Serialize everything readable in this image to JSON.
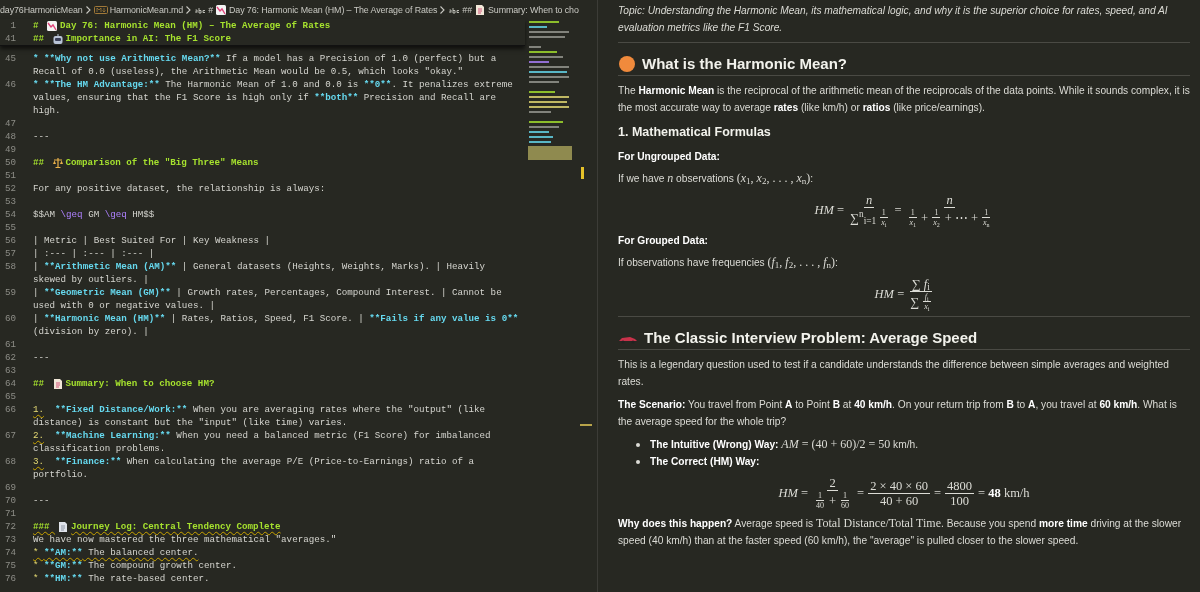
{
  "breadcrumbs": [
    {
      "kind": "folder",
      "text": "day76HarmonicMean"
    },
    {
      "kind": "file",
      "text": "HarmonicMean.md"
    },
    {
      "kind": "heading",
      "marker": "#",
      "emoji": true,
      "text": "Day 76: Harmonic Mean (HM) – The Average of Rates"
    },
    {
      "kind": "heading",
      "marker": "##",
      "emoji": true,
      "text": "Summary: When to cho"
    }
  ],
  "editor": {
    "sticky": [
      {
        "number": "1",
        "rows": [
          [
            {
              "kind": "heading",
              "text": "# "
            },
            {
              "kind": "emoji"
            },
            {
              "kind": "heading",
              "text": "Day 76: Harmonic Mean (HM) – The Average of Rates"
            }
          ]
        ]
      },
      {
        "number": "41",
        "rows": [
          [
            {
              "kind": "heading",
              "text": "## "
            },
            {
              "kind": "emoji"
            },
            {
              "kind": "heading",
              "text": "Importance in AI: The F1 Score"
            }
          ]
        ]
      }
    ],
    "lines": [
      {
        "number": "45",
        "rows": [
          [
            {
              "kind": "bold",
              "text": "* **Why not use Arithmetic Mean?**"
            },
            {
              "kind": "text",
              "text": " If a model has a Precision of 1.0 (perfect) but a"
            }
          ],
          [
            {
              "kind": "text",
              "text": "Recall of 0.0 (useless), the Arithmetic Mean would be 0.5, which looks \"okay.\""
            }
          ]
        ]
      },
      {
        "number": "46",
        "rows": [
          [
            {
              "kind": "bold",
              "text": "* **The HM Advantage:**"
            },
            {
              "kind": "text",
              "text": " The Harmonic Mean of 1.0 and 0.0 is "
            },
            {
              "kind": "bold",
              "text": "**0**"
            },
            {
              "kind": "text",
              "text": ". It penalizes extreme"
            }
          ],
          [
            {
              "kind": "text",
              "text": "values, ensuring that the F1 Score is high only if "
            },
            {
              "kind": "bold",
              "text": "**both**"
            },
            {
              "kind": "text",
              "text": " Precision and Recall are"
            }
          ],
          [
            {
              "kind": "text",
              "text": "high."
            }
          ]
        ]
      },
      {
        "number": "47"
      },
      {
        "number": "48",
        "rows": [
          [
            {
              "kind": "text",
              "text": "---"
            }
          ]
        ]
      },
      {
        "number": "49"
      },
      {
        "number": "50",
        "rows": [
          [
            {
              "kind": "heading",
              "text": "## "
            },
            {
              "kind": "emoji"
            },
            {
              "kind": "heading",
              "text": "Comparison of the \"Big Three\" Means"
            }
          ]
        ]
      },
      {
        "number": "51"
      },
      {
        "number": "52",
        "rows": [
          [
            {
              "kind": "text",
              "text": "For any positive dataset, the relationship is always:"
            }
          ]
        ]
      },
      {
        "number": "53"
      },
      {
        "number": "54",
        "rows": [
          [
            {
              "kind": "text",
              "text": "$$AM "
            },
            {
              "kind": "command",
              "text": "\\geq"
            },
            {
              "kind": "text",
              "text": " GM "
            },
            {
              "kind": "command",
              "text": "\\geq"
            },
            {
              "kind": "text",
              "text": " HM$$"
            }
          ]
        ]
      },
      {
        "number": "55"
      },
      {
        "number": "56",
        "rows": [
          [
            {
              "kind": "text",
              "text": "| Metric | Best Suited For | Key Weakness |"
            }
          ]
        ]
      },
      {
        "number": "57",
        "rows": [
          [
            {
              "kind": "text",
              "text": "| :--- | :--- | :--- |"
            }
          ]
        ]
      },
      {
        "number": "58",
        "rows": [
          [
            {
              "kind": "text",
              "text": "| "
            },
            {
              "kind": "bold",
              "text": "**Arithmetic Mean (AM)**"
            },
            {
              "kind": "text",
              "text": " | General datasets (Heights, Weights, Marks). | Heavily"
            }
          ],
          [
            {
              "kind": "text",
              "text": "skewed by outliers. |"
            }
          ]
        ]
      },
      {
        "number": "59",
        "rows": [
          [
            {
              "kind": "text",
              "text": "| "
            },
            {
              "kind": "bold",
              "text": "**Geometric Mean (GM)**"
            },
            {
              "kind": "text",
              "text": " | Growth rates, Percentages, Compound Interest. | Cannot be"
            }
          ],
          [
            {
              "kind": "text",
              "text": "used with 0 or negative values. |"
            }
          ]
        ]
      },
      {
        "number": "60",
        "rows": [
          [
            {
              "kind": "text",
              "text": "| "
            },
            {
              "kind": "bold",
              "text": "**Harmonic Mean (HM)**"
            },
            {
              "kind": "text",
              "text": " | Rates, Ratios, Speed, F1 Score. | "
            },
            {
              "kind": "bold",
              "text": "**Fails if any value is 0**"
            }
          ],
          [
            {
              "kind": "text",
              "text": "(division by zero). |"
            }
          ]
        ]
      },
      {
        "number": "61"
      },
      {
        "number": "62",
        "rows": [
          [
            {
              "kind": "text",
              "text": "---"
            }
          ]
        ]
      },
      {
        "number": "63"
      },
      {
        "number": "64",
        "rows": [
          [
            {
              "kind": "heading",
              "text": "## "
            },
            {
              "kind": "emoji"
            },
            {
              "kind": "heading",
              "text": "Summary: When to choose HM?"
            }
          ]
        ]
      },
      {
        "number": "65"
      },
      {
        "number": "66",
        "rows": [
          [
            {
              "kind": "list",
              "text": "1.",
              "squiggle": true
            },
            {
              "kind": "text",
              "text": "  "
            },
            {
              "kind": "bold",
              "text": "**Fixed Distance/Work:**"
            },
            {
              "kind": "text",
              "text": " When you are averaging rates where the \"output\" (like"
            }
          ],
          [
            {
              "kind": "text",
              "text": "distance) is constant but the \"input\" (like time) varies."
            }
          ]
        ]
      },
      {
        "number": "67",
        "rows": [
          [
            {
              "kind": "list",
              "text": "2.",
              "squiggle": true
            },
            {
              "kind": "text",
              "text": "  "
            },
            {
              "kind": "bold",
              "text": "**Machine Learning:**"
            },
            {
              "kind": "text",
              "text": " When you need a balanced metric (F1 Score) for imbalanced"
            }
          ],
          [
            {
              "kind": "text",
              "text": "classification problems."
            }
          ]
        ]
      },
      {
        "number": "68",
        "rows": [
          [
            {
              "kind": "list",
              "text": "3.",
              "squiggle": true
            },
            {
              "kind": "text",
              "text": "  "
            },
            {
              "kind": "bold",
              "text": "**Finance:**"
            },
            {
              "kind": "text",
              "text": " When calculating the average P/E (Price-to-Earnings) ratio of a"
            }
          ],
          [
            {
              "kind": "text",
              "text": "portfolio."
            }
          ]
        ]
      },
      {
        "number": "69"
      },
      {
        "number": "70",
        "rows": [
          [
            {
              "kind": "text",
              "text": "---"
            }
          ]
        ]
      },
      {
        "number": "71"
      },
      {
        "number": "72",
        "rows": [
          [
            {
              "kind": "heading",
              "text": "### ",
              "squiggle": true
            },
            {
              "kind": "emoji"
            },
            {
              "kind": "heading",
              "text": "Journey Log: Central Tendency Complete",
              "squiggle": true
            }
          ]
        ]
      },
      {
        "number": "73",
        "rows": [
          [
            {
              "kind": "text",
              "text": "We have now mastered the three mathematical \"averages.\""
            }
          ]
        ]
      },
      {
        "number": "74",
        "rows": [
          [
            {
              "kind": "list",
              "text": "* ",
              "squiggle": true
            },
            {
              "kind": "bold",
              "text": "**AM:**",
              "squiggle": true
            },
            {
              "kind": "text",
              "text": " The balanced center.",
              "squiggle": true
            }
          ]
        ]
      },
      {
        "number": "75",
        "rows": [
          [
            {
              "kind": "list",
              "text": "* "
            },
            {
              "kind": "bold",
              "text": "**GM:**"
            },
            {
              "kind": "text",
              "text": " The compound growth center."
            }
          ]
        ]
      },
      {
        "number": "76",
        "rows": [
          [
            {
              "kind": "list",
              "text": "* "
            },
            {
              "kind": "bold",
              "text": "**HM:**"
            },
            {
              "kind": "text",
              "text": " The rate-based center."
            }
          ]
        ]
      }
    ]
  },
  "preview": [
    {
      "kind": "paragraph",
      "italic": true,
      "segments": [
        {
          "kind": "text",
          "text": "Topic: Understanding the Harmonic Mean, its mathematical logic, and why it is the superior choice for rates, speed, and AI evaluation metrics like the F1 Score."
        }
      ]
    },
    {
      "kind": "rule"
    },
    {
      "kind": "heading2",
      "emoji": true,
      "text": "What is the Harmonic Mean?"
    },
    {
      "kind": "paragraph",
      "segments": [
        {
          "kind": "text",
          "text": "The **Harmonic Mean** is the reciprocal of the arithmetic mean of the reciprocals of the data points. While it sounds complex, it is the most accurate way to average **rates** (like km/h) or **ratios** (like price/earnings)."
        }
      ]
    },
    {
      "kind": "heading3",
      "text": "1. Mathematical Formulas"
    },
    {
      "kind": "heading4",
      "text": "For Ungrouped Data:"
    },
    {
      "kind": "paragraph",
      "segments": [
        {
          "kind": "text",
          "text": "If we have "
        },
        {
          "kind": "math",
          "text": "*n*"
        },
        {
          "kind": "text",
          "text": " observations "
        },
        {
          "kind": "math",
          "text": "(*x*$_{1}$, *x*$_{2}$, . . . , *x*$_{n}$)"
        },
        {
          "kind": "text",
          "text": ":"
        }
      ]
    },
    {
      "kind": "formula",
      "terms": [
        {
          "kind": "text",
          "text": "*HM* ="
        },
        {
          "kind": "frac",
          "num": [
            {
              "kind": "text",
              "text": "*n*"
            }
          ],
          "den": [
            {
              "kind": "text",
              "text": "∑$^{n}$$_{i=1}$"
            },
            {
              "kind": "frac",
              "num": [
                {
                  "kind": "text",
                  "text": "1"
                }
              ],
              "den": [
                {
                  "kind": "text",
                  "text": "*x*$_{i}$"
                }
              ]
            }
          ]
        },
        {
          "kind": "text",
          "text": "="
        },
        {
          "kind": "frac",
          "num": [
            {
              "kind": "text",
              "text": "*n*"
            }
          ],
          "den": [
            {
              "kind": "frac",
              "num": [
                {
                  "kind": "text",
                  "text": "1"
                }
              ],
              "den": [
                {
                  "kind": "text",
                  "text": "*x*$_{1}$"
                }
              ]
            },
            {
              "kind": "text",
              "text": "+"
            },
            {
              "kind": "frac",
              "num": [
                {
                  "kind": "text",
                  "text": "1"
                }
              ],
              "den": [
                {
                  "kind": "text",
                  "text": "*x*$_{2}$"
                }
              ]
            },
            {
              "kind": "text",
              "text": "+ ⋯ +"
            },
            {
              "kind": "frac",
              "num": [
                {
                  "kind": "text",
                  "text": "1"
                }
              ],
              "den": [
                {
                  "kind": "text",
                  "text": "*x*$_{n}$"
                }
              ]
            }
          ]
        }
      ]
    },
    {
      "kind": "heading4",
      "text": "For Grouped Data:"
    },
    {
      "kind": "paragraph",
      "segments": [
        {
          "kind": "text",
          "text": "If observations have frequencies "
        },
        {
          "kind": "math",
          "text": "(*f*$_{1}$, *f*$_{2}$, . . . , *f*$_{n}$)"
        },
        {
          "kind": "text",
          "text": ":"
        }
      ]
    },
    {
      "kind": "formula",
      "terms": [
        {
          "kind": "text",
          "text": "*HM* ="
        },
        {
          "kind": "frac",
          "num": [
            {
              "kind": "text",
              "text": "∑ *f*$_{i}$"
            }
          ],
          "den": [
            {
              "kind": "text",
              "text": "∑"
            },
            {
              "kind": "frac",
              "num": [
                {
                  "kind": "text",
                  "text": "*f*$_{i}$"
                }
              ],
              "den": [
                {
                  "kind": "text",
                  "text": "*x*$_{i}$"
                }
              ]
            }
          ]
        }
      ]
    },
    {
      "kind": "rule"
    },
    {
      "kind": "heading2",
      "emoji": true,
      "text": "The Classic Interview Problem: Average Speed"
    },
    {
      "kind": "paragraph",
      "segments": [
        {
          "kind": "text",
          "text": "This is a legendary question used to test if a candidate understands the difference between simple averages and weighted rates."
        }
      ]
    },
    {
      "kind": "paragraph",
      "segments": [
        {
          "kind": "text",
          "text": "**The Scenario:** You travel from Point **A** to Point **B** at **40 km/h**. On your return trip from **B** to **A**, you travel at **60 km/h**. What is the average speed for the whole trip?"
        }
      ]
    },
    {
      "kind": "bullets",
      "items": [
        {
          "segments": [
            {
              "kind": "text",
              "text": "**The Intuitive (Wrong) Way:** "
            },
            {
              "kind": "math",
              "text": "*AM* = (40 + 60)/2 = 50"
            },
            {
              "kind": "text",
              "text": " km/h."
            }
          ]
        },
        {
          "segments": [
            {
              "kind": "text",
              "text": "**The Correct (HM) Way:**"
            }
          ]
        }
      ]
    },
    {
      "kind": "formula",
      "terms": [
        {
          "kind": "text",
          "text": "*HM* ="
        },
        {
          "kind": "frac",
          "num": [
            {
              "kind": "text",
              "text": "2"
            }
          ],
          "den": [
            {
              "kind": "frac",
              "num": [
                {
                  "kind": "text",
                  "text": "1"
                }
              ],
              "den": [
                {
                  "kind": "text",
                  "text": "40"
                }
              ]
            },
            {
              "kind": "text",
              "text": "+"
            },
            {
              "kind": "frac",
              "num": [
                {
                  "kind": "text",
                  "text": "1"
                }
              ],
              "den": [
                {
                  "kind": "text",
                  "text": "60"
                }
              ]
            }
          ]
        },
        {
          "kind": "text",
          "text": "="
        },
        {
          "kind": "frac",
          "num": [
            {
              "kind": "text",
              "text": "2 × 40 × 60"
            }
          ],
          "den": [
            {
              "kind": "text",
              "text": "40 + 60"
            }
          ]
        },
        {
          "kind": "text",
          "text": "="
        },
        {
          "kind": "frac",
          "num": [
            {
              "kind": "text",
              "text": "4800"
            }
          ],
          "den": [
            {
              "kind": "text",
              "text": "100"
            }
          ]
        },
        {
          "kind": "text",
          "text": "= **48** km/h"
        }
      ]
    },
    {
      "kind": "paragraph",
      "segments": [
        {
          "kind": "text",
          "text": "**Why does this happen?** Average speed is "
        },
        {
          "kind": "math",
          "text": "Total Distance/Total Time"
        },
        {
          "kind": "text",
          "text": ". Because you spend **more time** driving at the slower speed (40 km/h) than at the faster speed (60 km/h), the \"average\" is pulled closer to the slower speed."
        }
      ]
    }
  ]
}
